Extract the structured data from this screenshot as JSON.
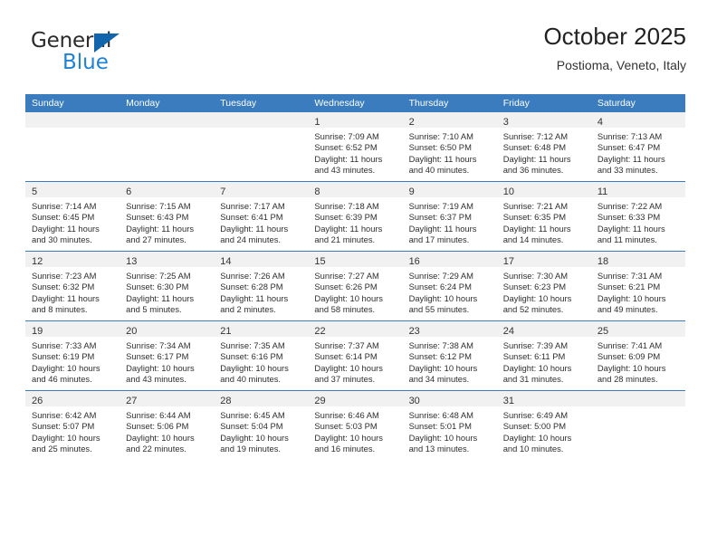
{
  "brand": {
    "name_part1": "General",
    "name_part2": "Blue",
    "triangle_color": "#1065ad",
    "blue_color": "#1e82d6"
  },
  "header": {
    "title": "October 2025",
    "subtitle": "Postioma, Veneto, Italy"
  },
  "theme": {
    "header_blue": "#3a7cbd",
    "daynum_band": "#f1f1f1",
    "text": "#2e2e2e"
  },
  "weekdays": [
    "Sunday",
    "Monday",
    "Tuesday",
    "Wednesday",
    "Thursday",
    "Friday",
    "Saturday"
  ],
  "weeks": [
    [
      {
        "day": ""
      },
      {
        "day": ""
      },
      {
        "day": ""
      },
      {
        "day": "1",
        "sunrise": "Sunrise: 7:09 AM",
        "sunset": "Sunset: 6:52 PM",
        "daylight1": "Daylight: 11 hours",
        "daylight2": "and 43 minutes."
      },
      {
        "day": "2",
        "sunrise": "Sunrise: 7:10 AM",
        "sunset": "Sunset: 6:50 PM",
        "daylight1": "Daylight: 11 hours",
        "daylight2": "and 40 minutes."
      },
      {
        "day": "3",
        "sunrise": "Sunrise: 7:12 AM",
        "sunset": "Sunset: 6:48 PM",
        "daylight1": "Daylight: 11 hours",
        "daylight2": "and 36 minutes."
      },
      {
        "day": "4",
        "sunrise": "Sunrise: 7:13 AM",
        "sunset": "Sunset: 6:47 PM",
        "daylight1": "Daylight: 11 hours",
        "daylight2": "and 33 minutes."
      }
    ],
    [
      {
        "day": "5",
        "sunrise": "Sunrise: 7:14 AM",
        "sunset": "Sunset: 6:45 PM",
        "daylight1": "Daylight: 11 hours",
        "daylight2": "and 30 minutes."
      },
      {
        "day": "6",
        "sunrise": "Sunrise: 7:15 AM",
        "sunset": "Sunset: 6:43 PM",
        "daylight1": "Daylight: 11 hours",
        "daylight2": "and 27 minutes."
      },
      {
        "day": "7",
        "sunrise": "Sunrise: 7:17 AM",
        "sunset": "Sunset: 6:41 PM",
        "daylight1": "Daylight: 11 hours",
        "daylight2": "and 24 minutes."
      },
      {
        "day": "8",
        "sunrise": "Sunrise: 7:18 AM",
        "sunset": "Sunset: 6:39 PM",
        "daylight1": "Daylight: 11 hours",
        "daylight2": "and 21 minutes."
      },
      {
        "day": "9",
        "sunrise": "Sunrise: 7:19 AM",
        "sunset": "Sunset: 6:37 PM",
        "daylight1": "Daylight: 11 hours",
        "daylight2": "and 17 minutes."
      },
      {
        "day": "10",
        "sunrise": "Sunrise: 7:21 AM",
        "sunset": "Sunset: 6:35 PM",
        "daylight1": "Daylight: 11 hours",
        "daylight2": "and 14 minutes."
      },
      {
        "day": "11",
        "sunrise": "Sunrise: 7:22 AM",
        "sunset": "Sunset: 6:33 PM",
        "daylight1": "Daylight: 11 hours",
        "daylight2": "and 11 minutes."
      }
    ],
    [
      {
        "day": "12",
        "sunrise": "Sunrise: 7:23 AM",
        "sunset": "Sunset: 6:32 PM",
        "daylight1": "Daylight: 11 hours",
        "daylight2": "and 8 minutes."
      },
      {
        "day": "13",
        "sunrise": "Sunrise: 7:25 AM",
        "sunset": "Sunset: 6:30 PM",
        "daylight1": "Daylight: 11 hours",
        "daylight2": "and 5 minutes."
      },
      {
        "day": "14",
        "sunrise": "Sunrise: 7:26 AM",
        "sunset": "Sunset: 6:28 PM",
        "daylight1": "Daylight: 11 hours",
        "daylight2": "and 2 minutes."
      },
      {
        "day": "15",
        "sunrise": "Sunrise: 7:27 AM",
        "sunset": "Sunset: 6:26 PM",
        "daylight1": "Daylight: 10 hours",
        "daylight2": "and 58 minutes."
      },
      {
        "day": "16",
        "sunrise": "Sunrise: 7:29 AM",
        "sunset": "Sunset: 6:24 PM",
        "daylight1": "Daylight: 10 hours",
        "daylight2": "and 55 minutes."
      },
      {
        "day": "17",
        "sunrise": "Sunrise: 7:30 AM",
        "sunset": "Sunset: 6:23 PM",
        "daylight1": "Daylight: 10 hours",
        "daylight2": "and 52 minutes."
      },
      {
        "day": "18",
        "sunrise": "Sunrise: 7:31 AM",
        "sunset": "Sunset: 6:21 PM",
        "daylight1": "Daylight: 10 hours",
        "daylight2": "and 49 minutes."
      }
    ],
    [
      {
        "day": "19",
        "sunrise": "Sunrise: 7:33 AM",
        "sunset": "Sunset: 6:19 PM",
        "daylight1": "Daylight: 10 hours",
        "daylight2": "and 46 minutes."
      },
      {
        "day": "20",
        "sunrise": "Sunrise: 7:34 AM",
        "sunset": "Sunset: 6:17 PM",
        "daylight1": "Daylight: 10 hours",
        "daylight2": "and 43 minutes."
      },
      {
        "day": "21",
        "sunrise": "Sunrise: 7:35 AM",
        "sunset": "Sunset: 6:16 PM",
        "daylight1": "Daylight: 10 hours",
        "daylight2": "and 40 minutes."
      },
      {
        "day": "22",
        "sunrise": "Sunrise: 7:37 AM",
        "sunset": "Sunset: 6:14 PM",
        "daylight1": "Daylight: 10 hours",
        "daylight2": "and 37 minutes."
      },
      {
        "day": "23",
        "sunrise": "Sunrise: 7:38 AM",
        "sunset": "Sunset: 6:12 PM",
        "daylight1": "Daylight: 10 hours",
        "daylight2": "and 34 minutes."
      },
      {
        "day": "24",
        "sunrise": "Sunrise: 7:39 AM",
        "sunset": "Sunset: 6:11 PM",
        "daylight1": "Daylight: 10 hours",
        "daylight2": "and 31 minutes."
      },
      {
        "day": "25",
        "sunrise": "Sunrise: 7:41 AM",
        "sunset": "Sunset: 6:09 PM",
        "daylight1": "Daylight: 10 hours",
        "daylight2": "and 28 minutes."
      }
    ],
    [
      {
        "day": "26",
        "sunrise": "Sunrise: 6:42 AM",
        "sunset": "Sunset: 5:07 PM",
        "daylight1": "Daylight: 10 hours",
        "daylight2": "and 25 minutes."
      },
      {
        "day": "27",
        "sunrise": "Sunrise: 6:44 AM",
        "sunset": "Sunset: 5:06 PM",
        "daylight1": "Daylight: 10 hours",
        "daylight2": "and 22 minutes."
      },
      {
        "day": "28",
        "sunrise": "Sunrise: 6:45 AM",
        "sunset": "Sunset: 5:04 PM",
        "daylight1": "Daylight: 10 hours",
        "daylight2": "and 19 minutes."
      },
      {
        "day": "29",
        "sunrise": "Sunrise: 6:46 AM",
        "sunset": "Sunset: 5:03 PM",
        "daylight1": "Daylight: 10 hours",
        "daylight2": "and 16 minutes."
      },
      {
        "day": "30",
        "sunrise": "Sunrise: 6:48 AM",
        "sunset": "Sunset: 5:01 PM",
        "daylight1": "Daylight: 10 hours",
        "daylight2": "and 13 minutes."
      },
      {
        "day": "31",
        "sunrise": "Sunrise: 6:49 AM",
        "sunset": "Sunset: 5:00 PM",
        "daylight1": "Daylight: 10 hours",
        "daylight2": "and 10 minutes."
      },
      {
        "day": ""
      }
    ]
  ]
}
